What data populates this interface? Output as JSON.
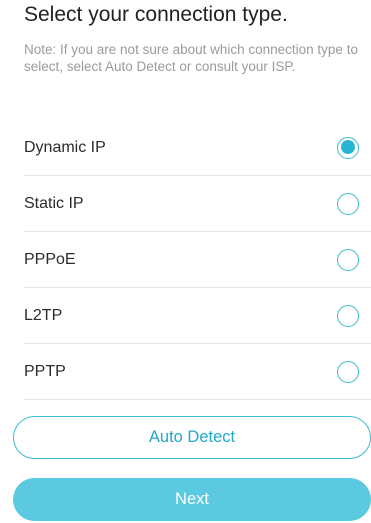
{
  "header": {
    "title": "Select your connection type.",
    "note": "Note: If you are not sure about which connection type to select, select Auto Detect or consult your ISP."
  },
  "options": [
    {
      "label": "Dynamic IP",
      "selected": true
    },
    {
      "label": "Static IP",
      "selected": false
    },
    {
      "label": "PPPoE",
      "selected": false
    },
    {
      "label": "L2TP",
      "selected": false
    },
    {
      "label": "PPTP",
      "selected": false
    }
  ],
  "buttons": {
    "auto_detect": "Auto Detect",
    "next": "Next"
  },
  "colors": {
    "accent": "#26b5d3",
    "button_fill": "#5bc9df",
    "note_text": "#9b9b9b"
  }
}
